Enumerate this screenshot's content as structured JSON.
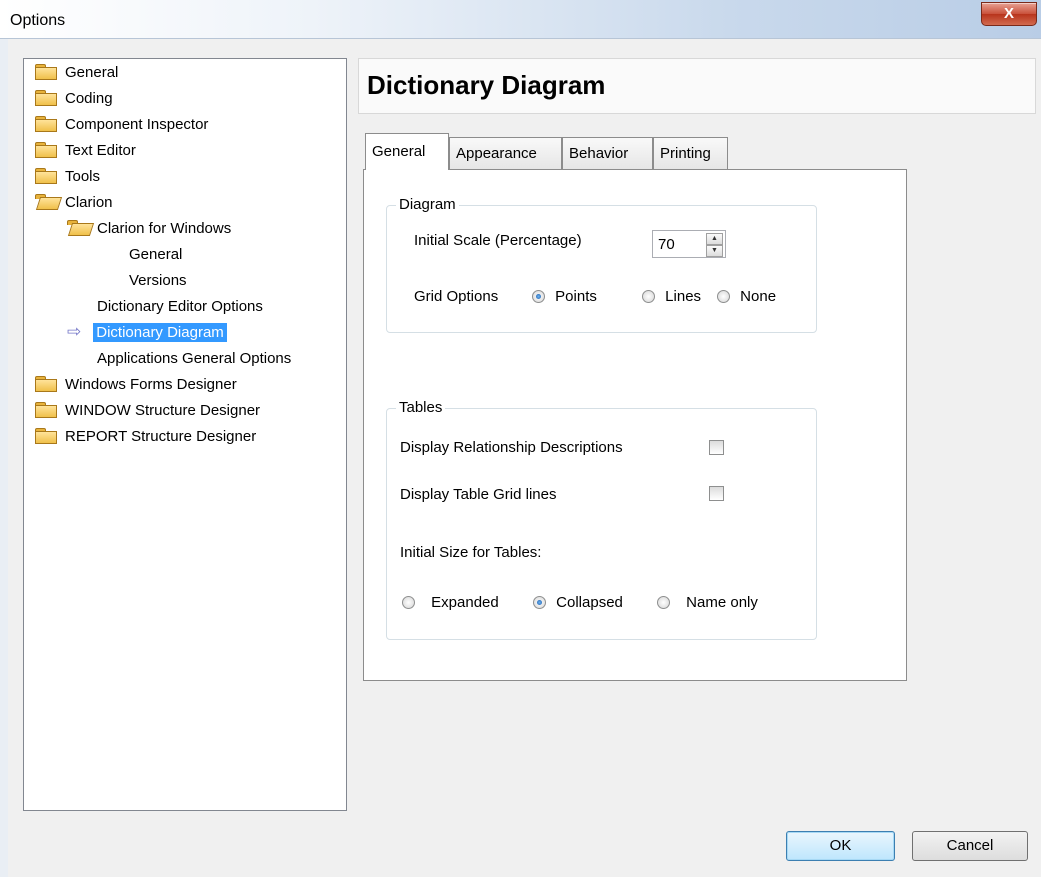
{
  "window": {
    "title": "Options",
    "close_glyph": "X"
  },
  "tree": {
    "items": [
      {
        "label": "General",
        "icon": "folder-icon"
      },
      {
        "label": "Coding",
        "icon": "folder-icon"
      },
      {
        "label": "Component Inspector",
        "icon": "folder-icon"
      },
      {
        "label": "Text Editor",
        "icon": "folder-icon"
      },
      {
        "label": "Tools",
        "icon": "folder-icon"
      },
      {
        "label": "Clarion",
        "icon": "folder-open-icon"
      },
      {
        "label": "Clarion for Windows",
        "icon": "folder-open-icon"
      },
      {
        "label": "General"
      },
      {
        "label": "Versions"
      },
      {
        "label": "Dictionary Editor Options"
      },
      {
        "label": "Dictionary Diagram",
        "selected": true,
        "icon": "arrow-right-icon"
      },
      {
        "label": "Applications General Options"
      },
      {
        "label": "Windows Forms Designer",
        "icon": "folder-icon"
      },
      {
        "label": "WINDOW Structure Designer",
        "icon": "folder-icon"
      },
      {
        "label": "REPORT Structure Designer",
        "icon": "folder-icon"
      }
    ],
    "selection_color": "#3399ff"
  },
  "header": {
    "title": "Dictionary Diagram"
  },
  "tabs": [
    {
      "label": "General",
      "active": true
    },
    {
      "label": "Appearance"
    },
    {
      "label": "Behavior"
    },
    {
      "label": "Printing"
    }
  ],
  "diagram_group": {
    "legend": "Diagram",
    "scale_label": "Initial Scale (Percentage)",
    "scale_value": "70",
    "grid_label": "Grid Options",
    "grid_options": [
      {
        "label": "Points",
        "checked": true
      },
      {
        "label": "Lines",
        "checked": false
      },
      {
        "label": "None",
        "checked": false
      }
    ]
  },
  "tables_group": {
    "legend": "Tables",
    "rel_desc_label": "Display Relationship Descriptions",
    "rel_desc_checked": false,
    "grid_lines_label": "Display Table Grid lines",
    "grid_lines_checked": false,
    "size_label": "Initial Size for Tables:",
    "size_options": [
      {
        "label": "Expanded",
        "checked": false
      },
      {
        "label": "Collapsed",
        "checked": true
      },
      {
        "label": "Name only",
        "checked": false
      }
    ]
  },
  "buttons": {
    "ok": "OK",
    "cancel": "Cancel"
  }
}
